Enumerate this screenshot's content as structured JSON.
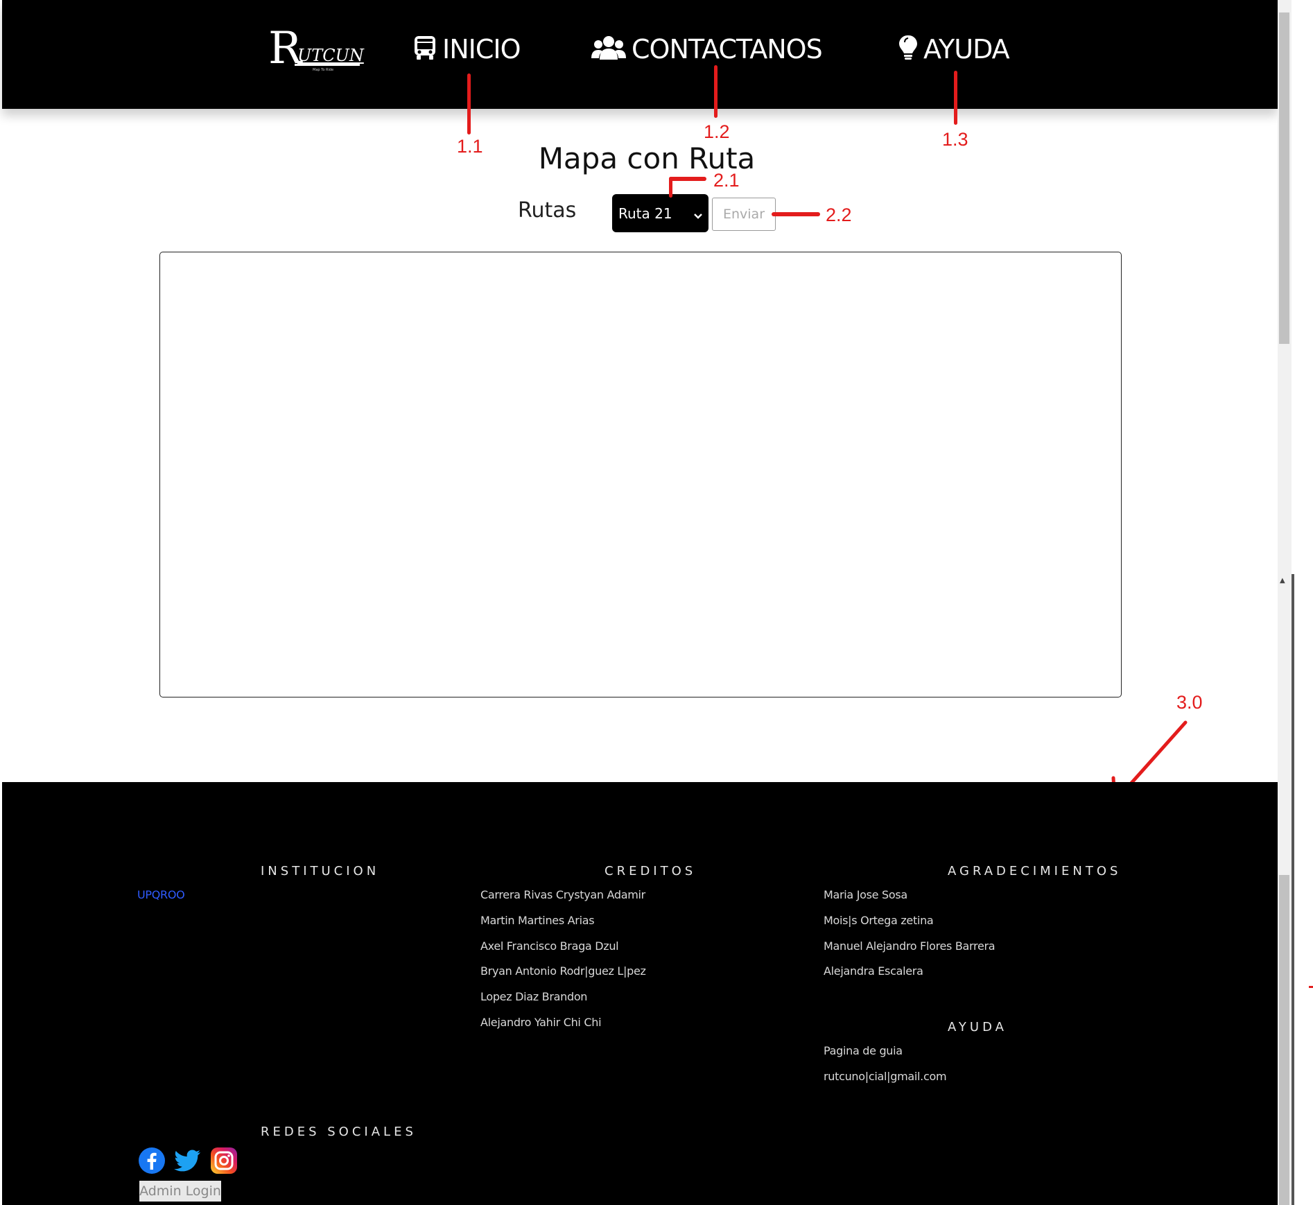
{
  "nav": {
    "logo_text": "RUTCUN",
    "logo_big_letter": "R",
    "logo_rest": "UTCUN",
    "logo_tagline": "Map To Ride",
    "items": [
      {
        "label": "INICIO",
        "icon": "bus-icon"
      },
      {
        "label": "CONTACTANOS",
        "icon": "users-icon"
      },
      {
        "label": "AYUDA",
        "icon": "lightbulb-icon"
      }
    ]
  },
  "annotations": {
    "a11": "1.1",
    "a12": "1.2",
    "a13": "1.3",
    "a21": "2.1",
    "a22": "2.2",
    "a30": "3.0"
  },
  "main": {
    "title": "Mapa con Ruta",
    "rutas_label": "Rutas",
    "select_value": "Ruta 21",
    "submit_label": "Enviar"
  },
  "footer": {
    "institucion": {
      "heading": "INSTITUCION",
      "link": "UPQROO"
    },
    "creditos": {
      "heading": "CREDITOS",
      "names": [
        "Carrera Rivas Crystyan Adamir",
        "Martin Martines Arias",
        "Axel Francisco Braga Dzul",
        "Bryan Antonio Rodr|guez L|pez",
        "Lopez Diaz Brandon",
        "Alejandro Yahir Chi Chi"
      ]
    },
    "agradecimientos": {
      "heading": "AGRADECIMIENTOS",
      "names": [
        "Maria Jose Sosa",
        "Mois|s Ortega zetina",
        "Manuel Alejandro Flores Barrera",
        "Alejandra Escalera"
      ]
    },
    "ayuda": {
      "heading": "AYUDA",
      "links": [
        "Pagina de guia",
        "rutcuno|cial|gmail.com"
      ]
    },
    "redes": {
      "heading": "REDES SOCIALES",
      "icons": [
        "facebook-icon",
        "twitter-icon",
        "instagram-icon"
      ]
    },
    "admin_login": "Admin Login"
  },
  "colors": {
    "nav_bg": "#000000",
    "annotation_red": "#e31c1c",
    "link_blue": "#2f5bff"
  }
}
